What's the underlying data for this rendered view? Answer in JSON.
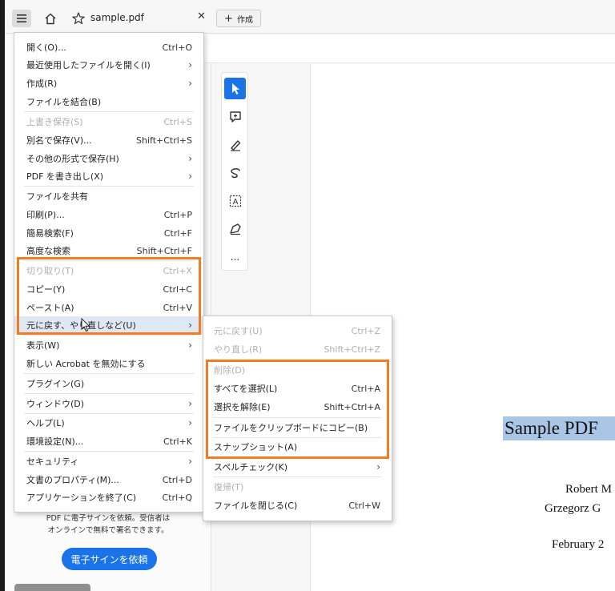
{
  "tab": {
    "title": "sample.pdf",
    "close": "✕",
    "new_tab_label": "作成",
    "new_tab_plus": "+"
  },
  "menu": {
    "items": [
      {
        "label": "開く(O)...",
        "shortcut": "Ctrl+O"
      },
      {
        "label": "最近使用したファイルを開く(I)",
        "arrow": "›"
      },
      {
        "label": "作成(R)",
        "arrow": "›"
      },
      {
        "label": "ファイルを結合(B)"
      },
      {
        "label": "上書き保存(S)",
        "shortcut": "Ctrl+S"
      },
      {
        "label": "別名で保存(V)...",
        "shortcut": "Shift+Ctrl+S"
      },
      {
        "label": "その他の形式で保存(H)",
        "arrow": "›"
      },
      {
        "label": "PDF を書き出し(X)",
        "arrow": "›"
      },
      {
        "label": "ファイルを共有"
      },
      {
        "label": "印刷(P)...",
        "shortcut": "Ctrl+P"
      },
      {
        "label": "簡易検索(F)",
        "shortcut": "Ctrl+F"
      },
      {
        "label": "高度な検索",
        "shortcut": "Shift+Ctrl+F"
      },
      {
        "label": "切り取り(T)",
        "shortcut": "Ctrl+X"
      },
      {
        "label": "コピー(Y)",
        "shortcut": "Ctrl+C"
      },
      {
        "label": "ペースト(A)",
        "shortcut": "Ctrl+V"
      },
      {
        "label": "元に戻す、やり直しなど(U)",
        "arrow": "›"
      },
      {
        "label": "表示(W)",
        "arrow": "›"
      },
      {
        "label": "新しい Acrobat を無効にする"
      },
      {
        "label": "プラグイン(G)"
      },
      {
        "label": "ウィンドウ(D)",
        "arrow": "›"
      },
      {
        "label": "ヘルプ(L)",
        "arrow": "›"
      },
      {
        "label": "環境設定(N)...",
        "shortcut": "Ctrl+K"
      },
      {
        "label": "セキュリティ",
        "arrow": "›"
      },
      {
        "label": "文書のプロパティ(M)...",
        "shortcut": "Ctrl+D"
      },
      {
        "label": "アプリケーションを終了(C)",
        "shortcut": "Ctrl+Q"
      }
    ]
  },
  "submenu": {
    "items": [
      {
        "label": "元に戻す(U)",
        "shortcut": "Ctrl+Z"
      },
      {
        "label": "やり直し(R)",
        "shortcut": "Shift+Ctrl+Z"
      },
      {
        "label": "削除(D)"
      },
      {
        "label": "すべてを選択(L)",
        "shortcut": "Ctrl+A"
      },
      {
        "label": "選択を解除(E)",
        "shortcut": "Shift+Ctrl+A"
      },
      {
        "label": "ファイルをクリップボードにコピー(B)"
      },
      {
        "label": "スナップショット(A)"
      },
      {
        "label": "スペルチェック(K)",
        "arrow": "›"
      },
      {
        "label": "復帰(T)"
      },
      {
        "label": "ファイルを閉じる(C)",
        "shortcut": "Ctrl+W"
      }
    ]
  },
  "promo": {
    "line1": "PDF に電子サインを依頼。受信者は",
    "line2": "オンラインで無料で署名できます。",
    "button": "電子サインを依頼"
  },
  "document": {
    "title": "Sample PDF",
    "author1": "Robert M",
    "author2": "Grzegorz G",
    "date": "February 2"
  },
  "tools": {
    "more": "..."
  },
  "colors": {
    "highlight": "#f47b22",
    "accent": "#1a73e8",
    "selection": "#a9c6e6"
  }
}
